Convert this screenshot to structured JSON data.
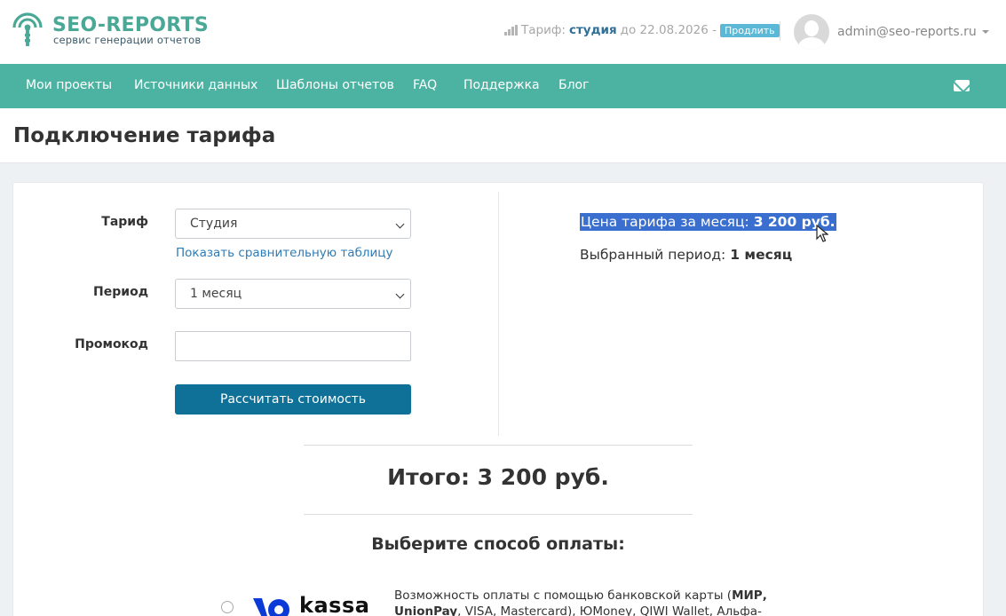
{
  "brand": {
    "name": "SEO-REPORTS",
    "tagline": "сервис генерации отчетов",
    "color": "#4aa897"
  },
  "header": {
    "tariff_prefix": "Тариф:",
    "tariff_name": "студия",
    "tariff_until": "до 22.08.2026 -",
    "extend_label": "Продлить",
    "user_email": "admin@seo-reports.ru"
  },
  "nav": {
    "items": [
      {
        "label": "Мои проекты"
      },
      {
        "label": "Источники данных"
      },
      {
        "label": "Шаблоны отчетов"
      },
      {
        "label": "FAQ"
      },
      {
        "label": "Поддержка"
      },
      {
        "label": "Блог"
      }
    ],
    "color": "#4cb3a2"
  },
  "page": {
    "title": "Подключение тарифа"
  },
  "form": {
    "tariff_label": "Тариф",
    "tariff_value": "Студия",
    "compare_link": "Показать сравнительную таблицу",
    "period_label": "Период",
    "period_value": "1 месяц",
    "promo_label": "Промокод",
    "promo_value": "",
    "calc_button": "Рассчитать стоимость"
  },
  "summary": {
    "price_label": "Цена тарифа за месяц:",
    "price_value": "3 200 руб.",
    "period_label": "Выбранный период:",
    "period_value": "1 месяц"
  },
  "total": "Итого: 3 200 руб.",
  "payment": {
    "heading": "Выберите способ оплаты:",
    "provider_logo_text": "kassa",
    "desc_prefix": "Возможность оплаты с помощью банковской карты (",
    "desc_bold": "МИР, UnionPay",
    "desc_rest": ", VISA, Mastercard), ЮMoney, QIWI Wallet, Альфа-клик"
  }
}
